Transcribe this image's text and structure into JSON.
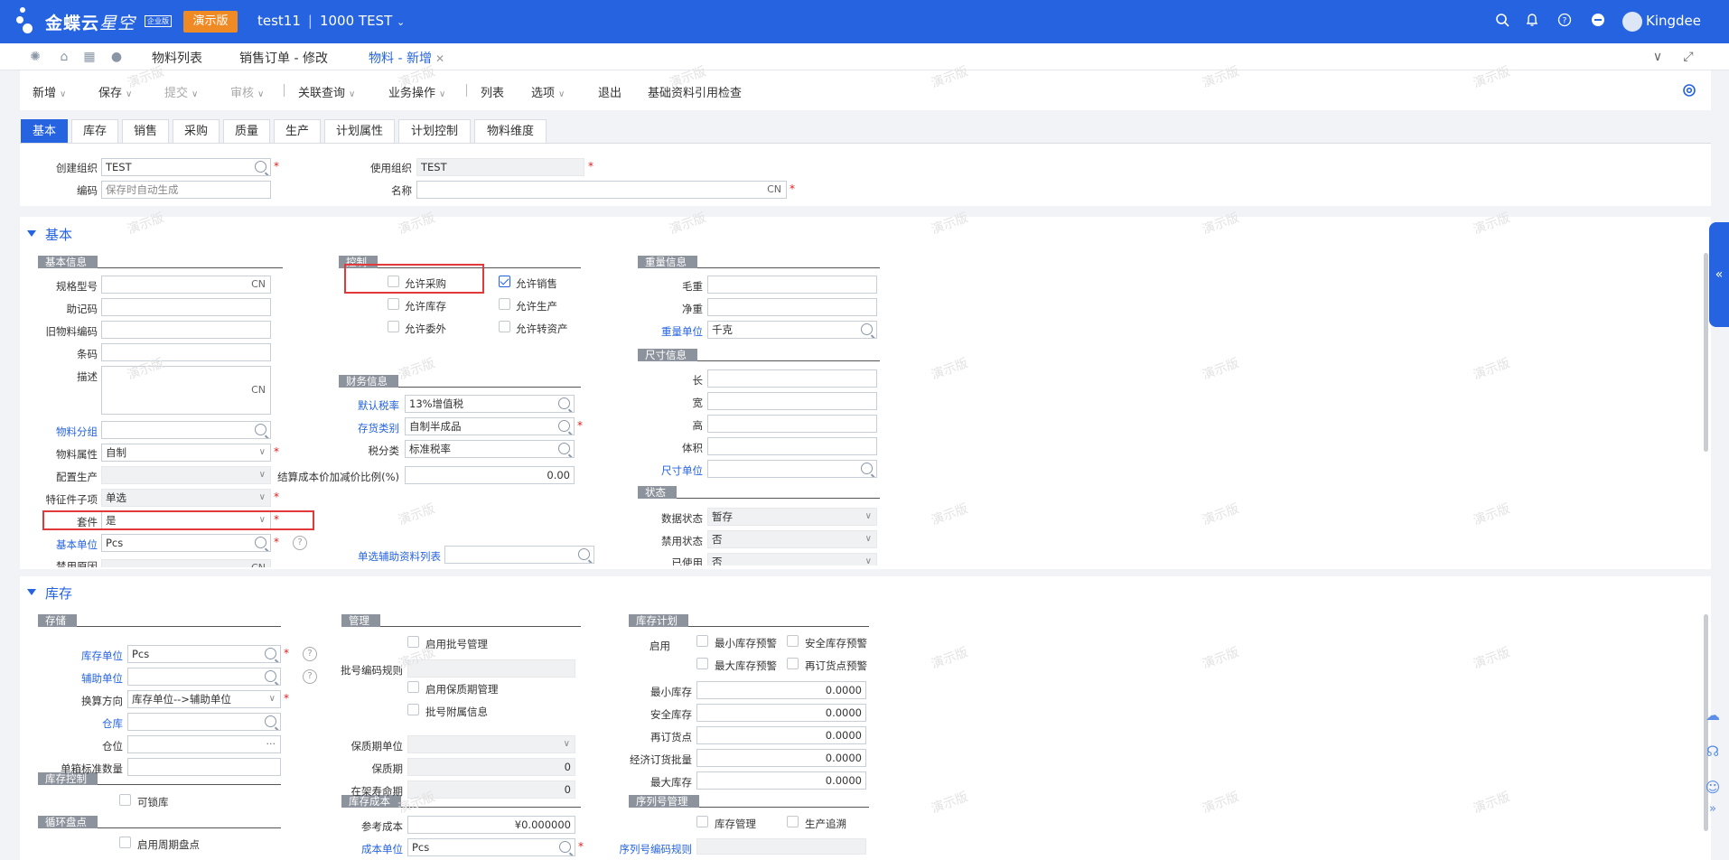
{
  "topbar": {
    "brand_main": "金蝶云",
    "brand_sub": "星空",
    "ent_badge": "企业版",
    "demo_badge": "演示版",
    "tenant": "test11",
    "org": "1000 TEST",
    "user": "Kingdee"
  },
  "icons": {
    "search": "search-icon",
    "bell": "bell-icon",
    "help": "help-icon",
    "more": "more-icon"
  },
  "tabs": [
    {
      "label": "物料列表"
    },
    {
      "label": "销售订单 - 修改"
    },
    {
      "label": "物料 - 新增"
    }
  ],
  "toolbar": {
    "new": "新增",
    "save": "保存",
    "submit": "提交",
    "audit": "审核",
    "related": "关联查询",
    "business": "业务操作",
    "list": "列表",
    "options": "选项",
    "exit": "退出",
    "basic_check": "基础资料引用检查"
  },
  "subtabs": [
    "基本",
    "库存",
    "销售",
    "采购",
    "质量",
    "生产",
    "计划属性",
    "计划控制",
    "物料维度"
  ],
  "header": {
    "create_org_label": "创建组织",
    "create_org": "TEST",
    "use_org_label": "使用组织",
    "use_org": "TEST",
    "code_label": "编码",
    "code_placeholder": "保存时自动生成",
    "name_label": "名称",
    "name_suffix": "CN"
  },
  "basic": {
    "title": "基本",
    "grp_info": "基本信息",
    "grp_control": "控制",
    "grp_weight": "重量信息",
    "grp_size": "尺寸信息",
    "grp_finance": "财务信息",
    "grp_status": "状态",
    "spec_label": "规格型号",
    "spec_suffix": "CN",
    "mnemonic_label": "助记码",
    "old_code_label": "旧物料编码",
    "barcode_label": "条码",
    "desc_label": "描述",
    "desc_suffix": "CN",
    "group_label": "物料分组",
    "prop_label": "物料属性",
    "prop_value": "自制",
    "config_label": "配置生产",
    "feature_label": "特征件子项",
    "feature_value": "单选",
    "kit_label": "套件",
    "kit_value": "是",
    "base_unit_label": "基本单位",
    "base_unit_value": "Pcs",
    "forbid_reason_label": "禁用原因",
    "forbid_reason_suffix": "CN",
    "allow_purchase": "允许采购",
    "allow_sale": "允许销售",
    "allow_stock": "允许库存",
    "allow_produce": "允许生产",
    "allow_outsource": "允许委外",
    "allow_asset": "允许转资产",
    "tax_rate_label": "默认税率",
    "tax_rate_value": "13%增值税",
    "stock_type_label": "存货类别",
    "stock_type_value": "自制半成品",
    "tax_class_label": "税分类",
    "tax_class_value": "标准税率",
    "cost_ratio_label": "结算成本价加减价比例(%)",
    "cost_ratio_value": "0.00",
    "aux_list_label": "单选辅助资料列表",
    "gross_label": "毛重",
    "net_label": "净重",
    "weight_unit_label": "重量单位",
    "weight_unit_value": "千克",
    "len_label": "长",
    "width_label": "宽",
    "height_label": "高",
    "volume_label": "体积",
    "size_unit_label": "尺寸单位",
    "data_status_label": "数据状态",
    "data_status_value": "暂存",
    "forbid_status_label": "禁用状态",
    "forbid_status_value": "否",
    "used_label": "已使用",
    "used_value": "否"
  },
  "stock": {
    "title": "库存",
    "grp_storage": "存储",
    "grp_manage": "管理",
    "grp_plan": "库存计划",
    "grp_control": "库存控制",
    "grp_cycle": "循环盘点",
    "grp_cost": "库存成本",
    "grp_serial": "序列号管理",
    "stock_unit_label": "库存单位",
    "stock_unit_value": "Pcs",
    "aux_unit_label": "辅助单位",
    "conv_label": "换算方向",
    "conv_value": "库存单位-->辅助单位",
    "warehouse_label": "仓库",
    "location_label": "仓位",
    "location_value": "···",
    "box_qty_label": "单箱标准数量",
    "lockable": "可锁库",
    "cycle_enable": "启用周期盘点",
    "batch_enable": "启用批号管理",
    "batch_rule_label": "批号编码规则",
    "shelf_enable": "启用保质期管理",
    "batch_attach": "批号附属信息",
    "shelf_unit_label": "保质期单位",
    "shelf_label": "保质期",
    "shelf_value": "0",
    "shelf_life_label": "在架寿命期",
    "shelf_life_value": "0",
    "ref_cost_label": "参考成本",
    "ref_cost_value": "¥0.000000",
    "cost_unit_label": "成本单位",
    "cost_unit_value": "Pcs",
    "enable_label": "启用",
    "min_warn": "最小库存预警",
    "safe_warn": "安全库存预警",
    "max_warn": "最大库存预警",
    "reorder_warn": "再订货点预警",
    "min_label": "最小库存",
    "min_value": "0.0000",
    "safe_label": "安全库存",
    "safe_value": "0.0000",
    "reorder_label": "再订货点",
    "reorder_value": "0.0000",
    "eoq_label": "经济订货批量",
    "eoq_value": "0.0000",
    "max_label": "最大库存",
    "max_value": "0.0000",
    "serial_stock": "库存管理",
    "serial_trace": "生产追溯",
    "serial_rule_label": "序列号编码规则"
  },
  "watermark": "演示版"
}
